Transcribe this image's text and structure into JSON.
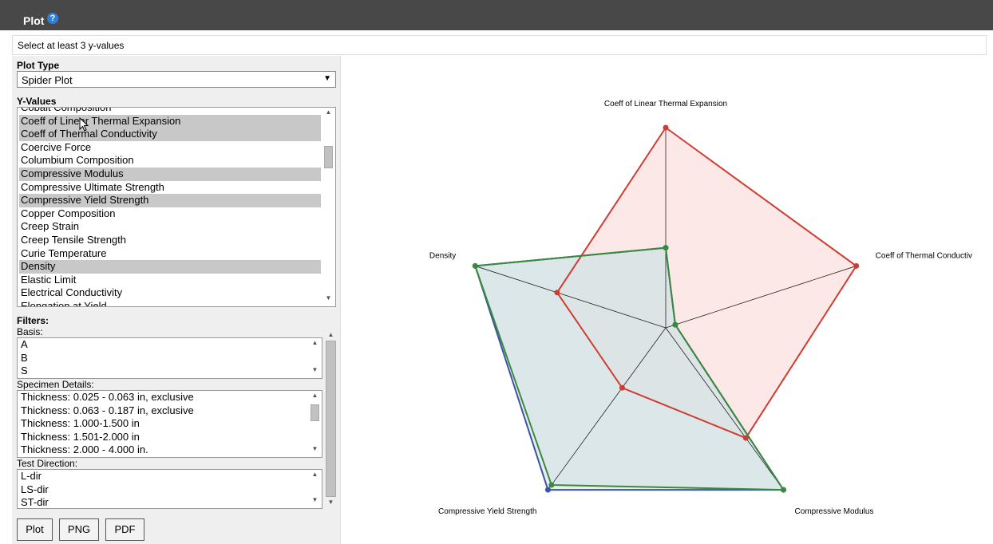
{
  "window": {
    "title": "Plot",
    "help_icon": "?"
  },
  "message": "Select at least 3 y-values",
  "plot_type": {
    "label": "Plot Type",
    "selected": "Spider Plot"
  },
  "y_values": {
    "label": "Y-Values",
    "items": [
      {
        "label": "Cobalt Composition",
        "selected": false
      },
      {
        "label": "Coeff of Linear Thermal Expansion",
        "selected": true
      },
      {
        "label": "Coeff of Thermal Conductivity",
        "selected": true
      },
      {
        "label": "Coercive Force",
        "selected": false
      },
      {
        "label": "Columbium Composition",
        "selected": false
      },
      {
        "label": "Compressive Modulus",
        "selected": true
      },
      {
        "label": "Compressive Ultimate Strength",
        "selected": false
      },
      {
        "label": "Compressive Yield Strength",
        "selected": true
      },
      {
        "label": "Copper Composition",
        "selected": false
      },
      {
        "label": "Creep Strain",
        "selected": false
      },
      {
        "label": "Creep Tensile Strength",
        "selected": false
      },
      {
        "label": "Curie Temperature",
        "selected": false
      },
      {
        "label": "Density",
        "selected": true
      },
      {
        "label": "Elastic Limit",
        "selected": false
      },
      {
        "label": "Electrical Conductivity",
        "selected": false
      },
      {
        "label": "Elongation at Yield",
        "selected": false
      }
    ]
  },
  "filters": {
    "label": "Filters:",
    "basis": {
      "label": "Basis:",
      "items": [
        "A",
        "B",
        "S"
      ]
    },
    "specimen": {
      "label": "Specimen Details:",
      "items": [
        "Thickness: 0.025 - 0.063 in, exclusive",
        "Thickness: 0.063 - 0.187 in, exclusive",
        "Thickness: 1.000-1.500 in",
        "Thickness: 1.501-2.000 in",
        "Thickness: 2.000 - 4.000 in."
      ]
    },
    "direction": {
      "label": "Test Direction:",
      "items": [
        "L-dir",
        "LS-dir",
        "ST-dir"
      ]
    }
  },
  "buttons": {
    "plot": "Plot",
    "png": "PNG",
    "pdf": "PDF"
  },
  "chart_data": {
    "type": "radar",
    "axes": [
      "Coeff of Linear Thermal Expansion",
      "Coeff of Thermal Conductiv",
      "Compressive Modulus",
      "Compressive Yield Strength",
      "Density"
    ],
    "range": [
      0,
      1
    ],
    "series": [
      {
        "color": "#d03b32",
        "fill": "#fde4e4",
        "values": [
          1.0,
          1.0,
          0.68,
          0.37,
          0.57
        ]
      },
      {
        "color": "#3d52a8",
        "fill": "#d6e2e4",
        "values": [
          0.4,
          0.05,
          1.0,
          1.0,
          1.0
        ]
      },
      {
        "color": "#3a8a3e",
        "fill": "#d6e2e4",
        "values": [
          0.4,
          0.05,
          1.0,
          0.97,
          1.0
        ]
      }
    ]
  }
}
